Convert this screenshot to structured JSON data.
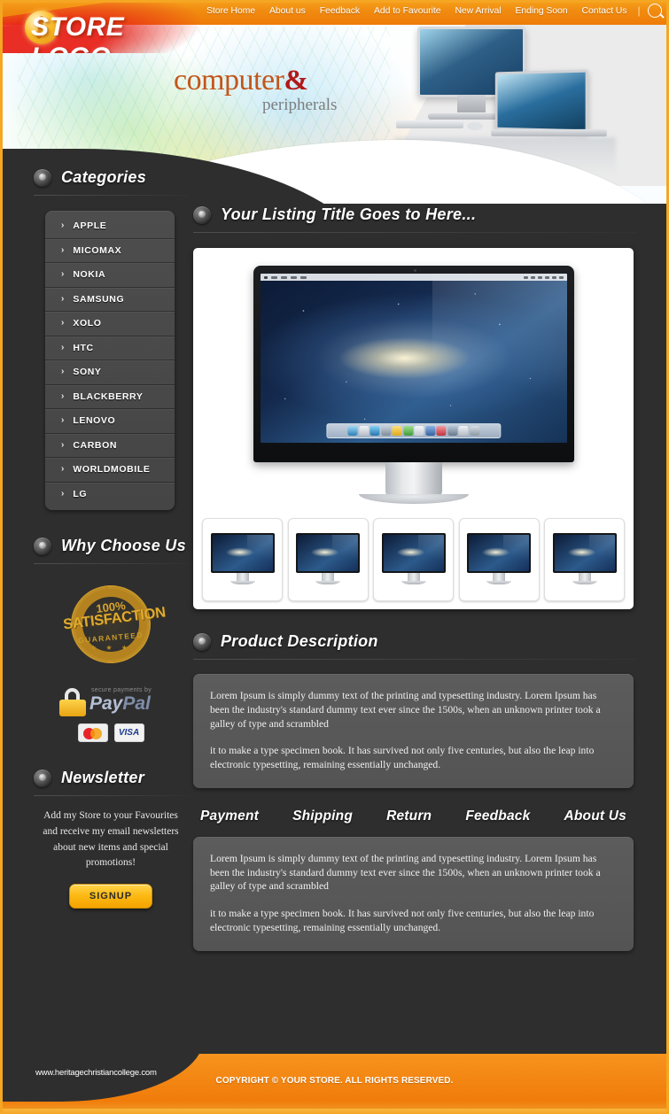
{
  "header": {
    "logo_text": "STORE LOGO",
    "nav": [
      {
        "label": "Store Home"
      },
      {
        "label": "About us"
      },
      {
        "label": "Feedback"
      },
      {
        "label": "Add to Favourite"
      },
      {
        "label": "New Arrival"
      },
      {
        "label": "Ending Soon"
      },
      {
        "label": "Contact Us"
      }
    ],
    "nav_separator": "|",
    "search_icon": "search-icon"
  },
  "banner": {
    "title_main": "computer",
    "title_amp": "&",
    "subtitle": "peripherals"
  },
  "sidebar": {
    "categories_title": "Categories",
    "categories": [
      {
        "label": "APPLE"
      },
      {
        "label": "MICOMAX"
      },
      {
        "label": "NOKIA"
      },
      {
        "label": "SAMSUNG"
      },
      {
        "label": "XOLO"
      },
      {
        "label": "HTC"
      },
      {
        "label": "SONY"
      },
      {
        "label": "BLACKBERRY"
      },
      {
        "label": "LENOVO"
      },
      {
        "label": "CARBON"
      },
      {
        "label": "WORLDMOBILE"
      },
      {
        "label": "LG"
      }
    ],
    "category_arrow": "›",
    "why_choose_title": "Why Choose Us",
    "badge": {
      "percent": "100%",
      "main": "SATISFACTION",
      "guarantee": "GUARANTEED",
      "stars": "★ ★ ★"
    },
    "paypal": {
      "secure_text": "secure payments by",
      "pay": "Pay",
      "pal": "Pal",
      "visa_label": "VISA"
    },
    "newsletter_title": "Newsletter",
    "newsletter_text": "Add my Store to your Favourites and receive my email newsletters about new items and special promotions!",
    "signup_label": "SIGNUP"
  },
  "main": {
    "listing_title": "Your Listing Title Goes to Here...",
    "apple_glyph": "",
    "thumbnails": [
      {
        "alt": "product-thumbnail-1"
      },
      {
        "alt": "product-thumbnail-2"
      },
      {
        "alt": "product-thumbnail-3"
      },
      {
        "alt": "product-thumbnail-4"
      },
      {
        "alt": "product-thumbnail-5"
      }
    ],
    "description_title": "Product Description",
    "description_p1": "Lorem Ipsum is simply dummy text of the printing and typesetting industry. Lorem Ipsum has been the industry's standard dummy text ever since the 1500s, when an unknown printer took a galley of type and scrambled",
    "description_p2": " it to make a type specimen book. It has survived not only five centuries, but also the leap into electronic typesetting, remaining essentially unchanged.",
    "tabs": [
      {
        "label": "Payment"
      },
      {
        "label": "Shipping"
      },
      {
        "label": "Return"
      },
      {
        "label": "Feedback"
      },
      {
        "label": "About Us"
      }
    ],
    "tab_p1": "Lorem Ipsum is simply dummy text of the printing and typesetting industry. Lorem Ipsum has been the industry's standard dummy text ever since the 1500s, when an unknown printer took a galley of type and scrambled",
    "tab_p2": " it to make a type specimen book. It has survived not only five centuries, but also the leap into electronic typesetting, remaining essentially unchanged."
  },
  "footer": {
    "url": "www.heritagechristiancollege.com",
    "copyright": "COPYRIGHT © YOUR STORE. ALL RIGHTS RESERVED."
  },
  "colors": {
    "accent_orange": "#f5a623",
    "header_orange": "#f08b10",
    "body_dark": "#2e2e2e",
    "panel_gray": "#565656",
    "gold": "#fcb913"
  }
}
